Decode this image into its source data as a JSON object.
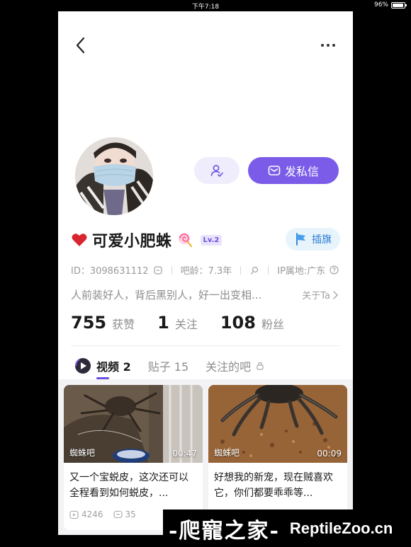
{
  "status_bar": {
    "time": "下午7:18",
    "battery": "96%",
    "battery_level": 0.96
  },
  "profile": {
    "name": "可爱小肥蛛",
    "level": "Lv.2",
    "flag_label": "插旗",
    "message_label": "发私信",
    "id_text": "ID：3098631112",
    "age_text": "吧龄：7.3年",
    "ip_text": "IP属地:广东",
    "bio": "人前装好人，背后黑别人，好一出变相...",
    "about_label": "关于Ta"
  },
  "stats": [
    {
      "value": "755",
      "label": "获赞"
    },
    {
      "value": "1",
      "label": "关注"
    },
    {
      "value": "108",
      "label": "粉丝"
    }
  ],
  "tabs": [
    {
      "label": "视频 2"
    },
    {
      "label": "贴子 15"
    },
    {
      "label": "关注的吧"
    }
  ],
  "cards": [
    {
      "forum": "蜘蛛吧",
      "duration": "00:47",
      "title": "又一个宝蜕皮，这次还可以全程看到如何蜕皮，...",
      "views": "4246",
      "comments": "35"
    },
    {
      "forum": "蜘蛛吧",
      "duration": "00:09",
      "title": "好想我的新宠，现在贼喜欢它，你们都要乖乖等..."
    }
  ],
  "watermark": {
    "left": "-爬寵之家-",
    "right": "ReptileZoo.cn"
  },
  "colors": {
    "accent": "#7a5ce9",
    "flag_bg": "#e8f4fb",
    "flag_text": "#2a7bd4"
  }
}
